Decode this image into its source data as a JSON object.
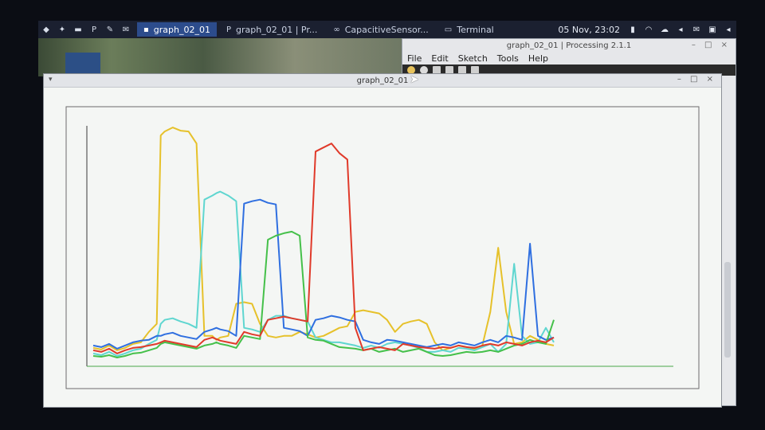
{
  "taskbar": {
    "tasks": [
      {
        "label": "graph_02_01",
        "glyph": "▪"
      },
      {
        "label": "graph_02_01 | Pr...",
        "glyph": "P"
      },
      {
        "label": "CapacitiveSensor...",
        "glyph": "∞"
      },
      {
        "label": "Terminal",
        "glyph": "▭"
      }
    ],
    "clock": "05 Nov, 23:02"
  },
  "editor": {
    "title": "graph_02_01 | Processing 2.1.1",
    "menu": [
      "File",
      "Edit",
      "Sketch",
      "Tools",
      "Help"
    ]
  },
  "graph_window": {
    "title": "graph_02_01"
  },
  "chart_data": {
    "type": "line",
    "x": [
      0,
      10,
      20,
      30,
      40,
      50,
      60,
      70,
      80,
      85,
      90,
      100,
      110,
      120,
      130,
      140,
      150,
      155,
      160,
      170,
      180,
      190,
      200,
      210,
      220,
      230,
      240,
      250,
      260,
      270,
      280,
      290,
      300,
      310,
      320,
      330,
      340,
      350,
      360,
      370,
      380,
      390,
      400,
      410,
      420,
      430,
      440,
      450,
      460,
      470,
      480,
      490,
      500,
      510,
      520,
      530,
      540,
      550,
      560,
      570,
      580
    ],
    "ylim": [
      0,
      300
    ],
    "grid": false,
    "series": [
      {
        "color": "#e6c12a",
        "values": [
          15,
          13,
          18,
          12,
          15,
          20,
          22,
          35,
          45,
          280,
          285,
          290,
          286,
          285,
          270,
          30,
          30,
          25,
          28,
          30,
          70,
          72,
          70,
          45,
          30,
          28,
          30,
          30,
          35,
          32,
          28,
          30,
          35,
          40,
          42,
          60,
          62,
          60,
          58,
          50,
          35,
          45,
          48,
          50,
          45,
          22,
          12,
          15,
          18,
          16,
          14,
          18,
          60,
          140,
          60,
          20,
          22,
          30,
          25,
          20,
          18
        ]
      },
      {
        "color": "#5fd6d0",
        "values": [
          8,
          6,
          10,
          5,
          8,
          12,
          14,
          20,
          25,
          45,
          50,
          52,
          48,
          45,
          40,
          200,
          205,
          208,
          210,
          205,
          198,
          40,
          38,
          35,
          50,
          55,
          55,
          52,
          50,
          48,
          28,
          25,
          22,
          22,
          20,
          18,
          15,
          18,
          15,
          20,
          22,
          20,
          18,
          15,
          10,
          10,
          12,
          10,
          15,
          14,
          12,
          16,
          20,
          10,
          20,
          120,
          30,
          20,
          22,
          40,
          22
        ]
      },
      {
        "color": "#2f6fe0",
        "values": [
          18,
          16,
          20,
          14,
          18,
          22,
          24,
          25,
          30,
          30,
          32,
          34,
          30,
          28,
          26,
          35,
          38,
          40,
          38,
          36,
          30,
          195,
          198,
          200,
          196,
          194,
          40,
          38,
          36,
          30,
          50,
          52,
          55,
          53,
          50,
          48,
          25,
          22,
          20,
          25,
          24,
          22,
          20,
          18,
          16,
          18,
          20,
          18,
          22,
          20,
          18,
          22,
          25,
          22,
          30,
          28,
          25,
          145,
          30,
          25,
          28
        ]
      },
      {
        "color": "#45c04a",
        "values": [
          5,
          4,
          6,
          3,
          5,
          8,
          9,
          12,
          15,
          20,
          22,
          20,
          18,
          16,
          14,
          18,
          20,
          22,
          20,
          18,
          15,
          30,
          28,
          26,
          150,
          155,
          158,
          160,
          155,
          28,
          25,
          24,
          20,
          16,
          15,
          14,
          12,
          14,
          10,
          12,
          14,
          10,
          12,
          14,
          10,
          6,
          5,
          6,
          8,
          10,
          9,
          10,
          12,
          10,
          14,
          18,
          20,
          25,
          22,
          20,
          50
        ]
      },
      {
        "color": "#e03a2a",
        "values": [
          12,
          10,
          14,
          8,
          12,
          15,
          16,
          18,
          20,
          22,
          24,
          22,
          20,
          18,
          16,
          25,
          28,
          26,
          24,
          22,
          20,
          35,
          32,
          30,
          50,
          52,
          54,
          52,
          50,
          48,
          260,
          265,
          270,
          258,
          250,
          40,
          12,
          14,
          16,
          14,
          12,
          20,
          18,
          16,
          15,
          14,
          16,
          15,
          18,
          16,
          15,
          18,
          20,
          18,
          22,
          20,
          18,
          22,
          24,
          22,
          28
        ]
      }
    ]
  }
}
